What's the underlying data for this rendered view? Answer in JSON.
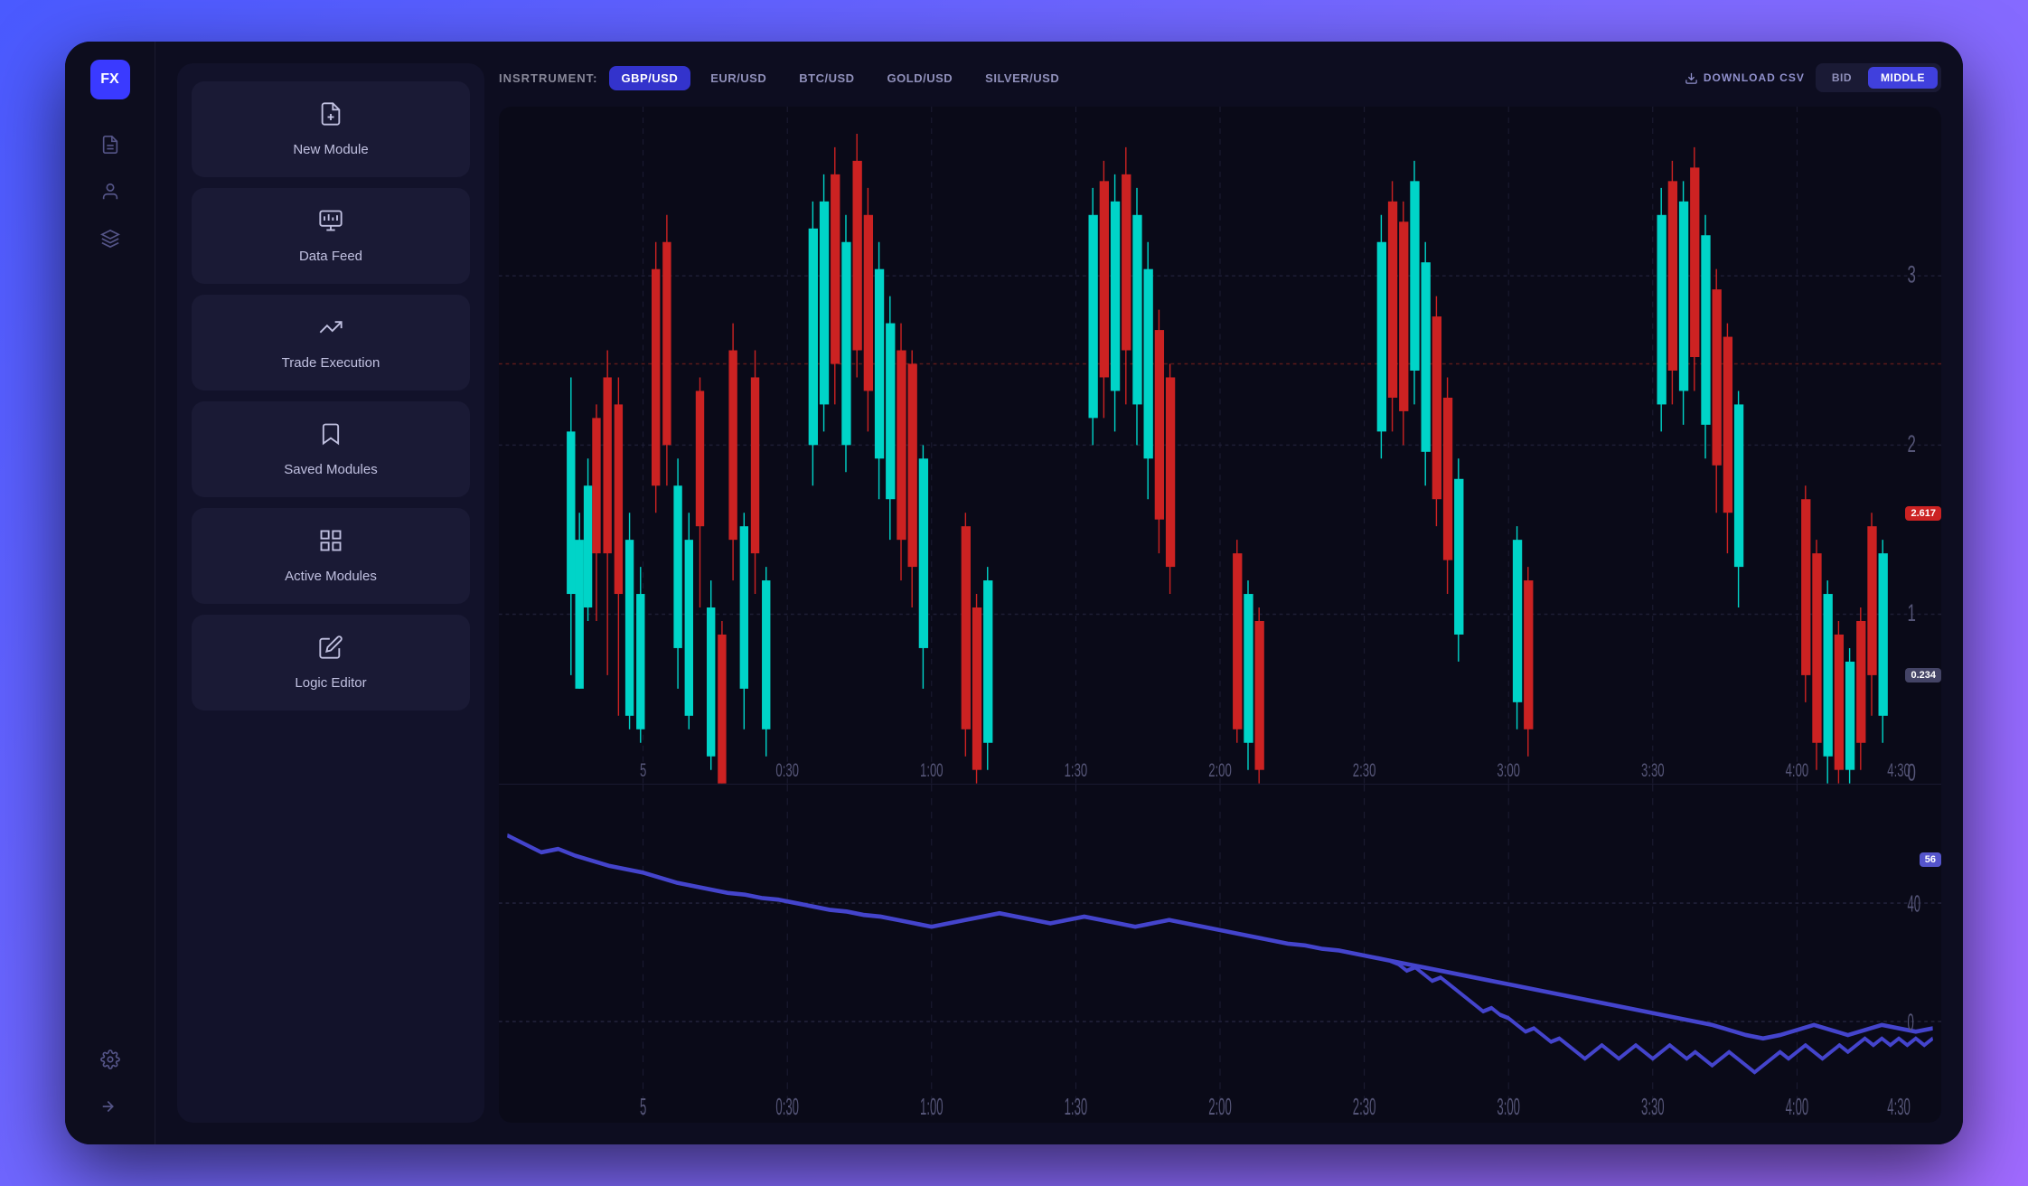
{
  "app": {
    "logo_text": "FX"
  },
  "sidebar_narrow": {
    "icons": [
      {
        "name": "document-icon",
        "glyph": "📄"
      },
      {
        "name": "user-icon",
        "glyph": "👤"
      },
      {
        "name": "layers-icon",
        "glyph": "⊞"
      },
      {
        "name": "settings-icon",
        "glyph": "⚙"
      },
      {
        "name": "export-icon",
        "glyph": "⊣"
      }
    ]
  },
  "left_panel": {
    "modules": [
      {
        "id": "new-module",
        "label": "New Module",
        "icon": "new-module-icon"
      },
      {
        "id": "data-feed",
        "label": "Data Feed",
        "icon": "data-feed-icon"
      },
      {
        "id": "trade-execution",
        "label": "Trade Execution",
        "icon": "trade-execution-icon"
      },
      {
        "id": "saved-modules",
        "label": "Saved Modules",
        "icon": "saved-modules-icon"
      },
      {
        "id": "active-modules",
        "label": "Active Modules",
        "icon": "active-modules-icon"
      },
      {
        "id": "logic-editor",
        "label": "Logic Editor",
        "icon": "logic-editor-icon"
      }
    ]
  },
  "chart_header": {
    "instrument_label": "INSRTRUMENT:",
    "tabs": [
      {
        "id": "gbp-usd",
        "label": "GBP/USD",
        "active": true
      },
      {
        "id": "eur-usd",
        "label": "EUR/USD",
        "active": false
      },
      {
        "id": "btc-usd",
        "label": "BTC/USD",
        "active": false
      },
      {
        "id": "gold-usd",
        "label": "GOLD/USD",
        "active": false
      },
      {
        "id": "silver-usd",
        "label": "SILVER/USD",
        "active": false
      }
    ],
    "download_label": "DOWNLOAD CSV",
    "price_types": [
      {
        "id": "bid",
        "label": "BID",
        "active": false
      },
      {
        "id": "middle",
        "label": "MIDDLE",
        "active": true
      }
    ]
  },
  "chart": {
    "price_high_label": "2.617",
    "price_low_label": "0.234",
    "oscillator_label": "56",
    "y_axis_candlestick": [
      "3",
      "2",
      "1",
      "0"
    ],
    "y_axis_oscillator": [
      "40",
      "0"
    ],
    "x_axis": [
      "5",
      "0:30",
      "1:00",
      "1:30",
      "2:00",
      "2:30",
      "3:00",
      "3:30",
      "4:00",
      "4:30"
    ]
  }
}
